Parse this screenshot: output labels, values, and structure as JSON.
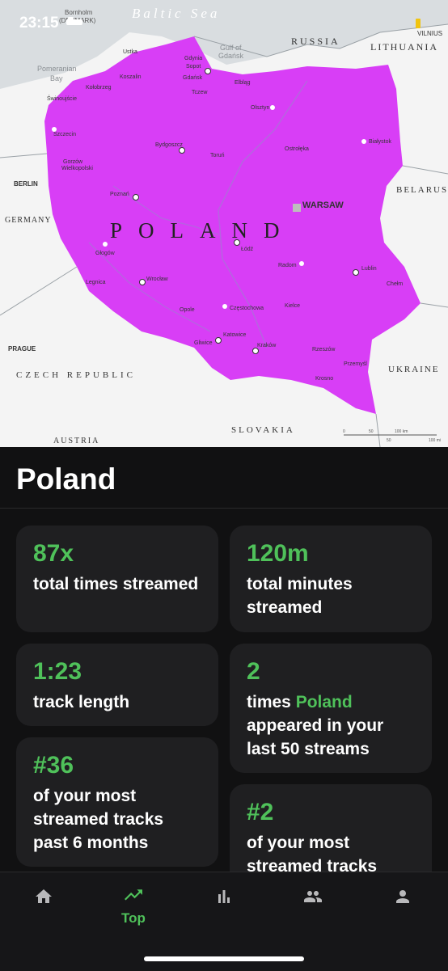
{
  "status": {
    "time": "23:15"
  },
  "map": {
    "country_label": "POLAND",
    "sea_label": "Baltic Sea",
    "capital": "WARSAW",
    "neighbors": [
      "RUSSIA",
      "LITHUANIA",
      "BELARUS",
      "UKRAINE",
      "SLOVAKIA",
      "CZECH REPUBLIC",
      "GERMANY",
      "AUSTRIA"
    ],
    "corner_labels": {
      "bornholm": "Bornholm (DENMARK)",
      "vilnius": "VILNIUS",
      "berlin": "BERLIN",
      "prague": "PRAGUE",
      "pomeranian": "Pomeranian Bay",
      "gulf": "Gulf of Gdańsk"
    },
    "cities": [
      "Ustka",
      "Gdynia",
      "Sopot",
      "Gdańsk",
      "Koszalin",
      "Kołobrzeg",
      "Świnoujście",
      "Elbląg",
      "Tczew",
      "Olsztyn",
      "Szczecin",
      "Bydgoszcz",
      "Toruń",
      "Ostrołęka",
      "Białystok",
      "Gorzów Wielkopolski",
      "Poznań",
      "Łódź",
      "Radom",
      "Lublin",
      "Chełm",
      "Głogów",
      "Legnica",
      "Wrocław",
      "Opole",
      "Częstochowa",
      "Kielce",
      "Gliwice",
      "Katowice",
      "Kraków",
      "Rzeszów",
      "Przemyśl",
      "Krosno"
    ],
    "scale": [
      "0",
      "50",
      "100 km",
      "50",
      "100 mi"
    ],
    "colors": {
      "country_fill": "#d83ef6",
      "land": "#f4f4f4",
      "sea": "#d9dde0"
    }
  },
  "header": {
    "title": "Poland"
  },
  "stats": [
    {
      "value": "87x",
      "desc": "total times streamed"
    },
    {
      "value": "120m",
      "desc": "total minutes streamed"
    },
    {
      "value": "1:23",
      "desc": "track length"
    },
    {
      "value": "2",
      "desc_pre": "times",
      "desc_highlight": "Poland",
      "desc_post": "appeared in your last 50 streams"
    },
    {
      "value": "#36",
      "desc": "of your most streamed tracks past 6 months"
    },
    {
      "value": "#2",
      "desc": "of your most streamed tracks"
    }
  ],
  "nav": {
    "items": [
      {
        "icon": "home-icon",
        "label": ""
      },
      {
        "icon": "trending-icon",
        "label": "Top"
      },
      {
        "icon": "bar-chart-icon",
        "label": ""
      },
      {
        "icon": "people-icon",
        "label": ""
      },
      {
        "icon": "person-icon",
        "label": ""
      }
    ],
    "active_color": "#4fc15a"
  }
}
